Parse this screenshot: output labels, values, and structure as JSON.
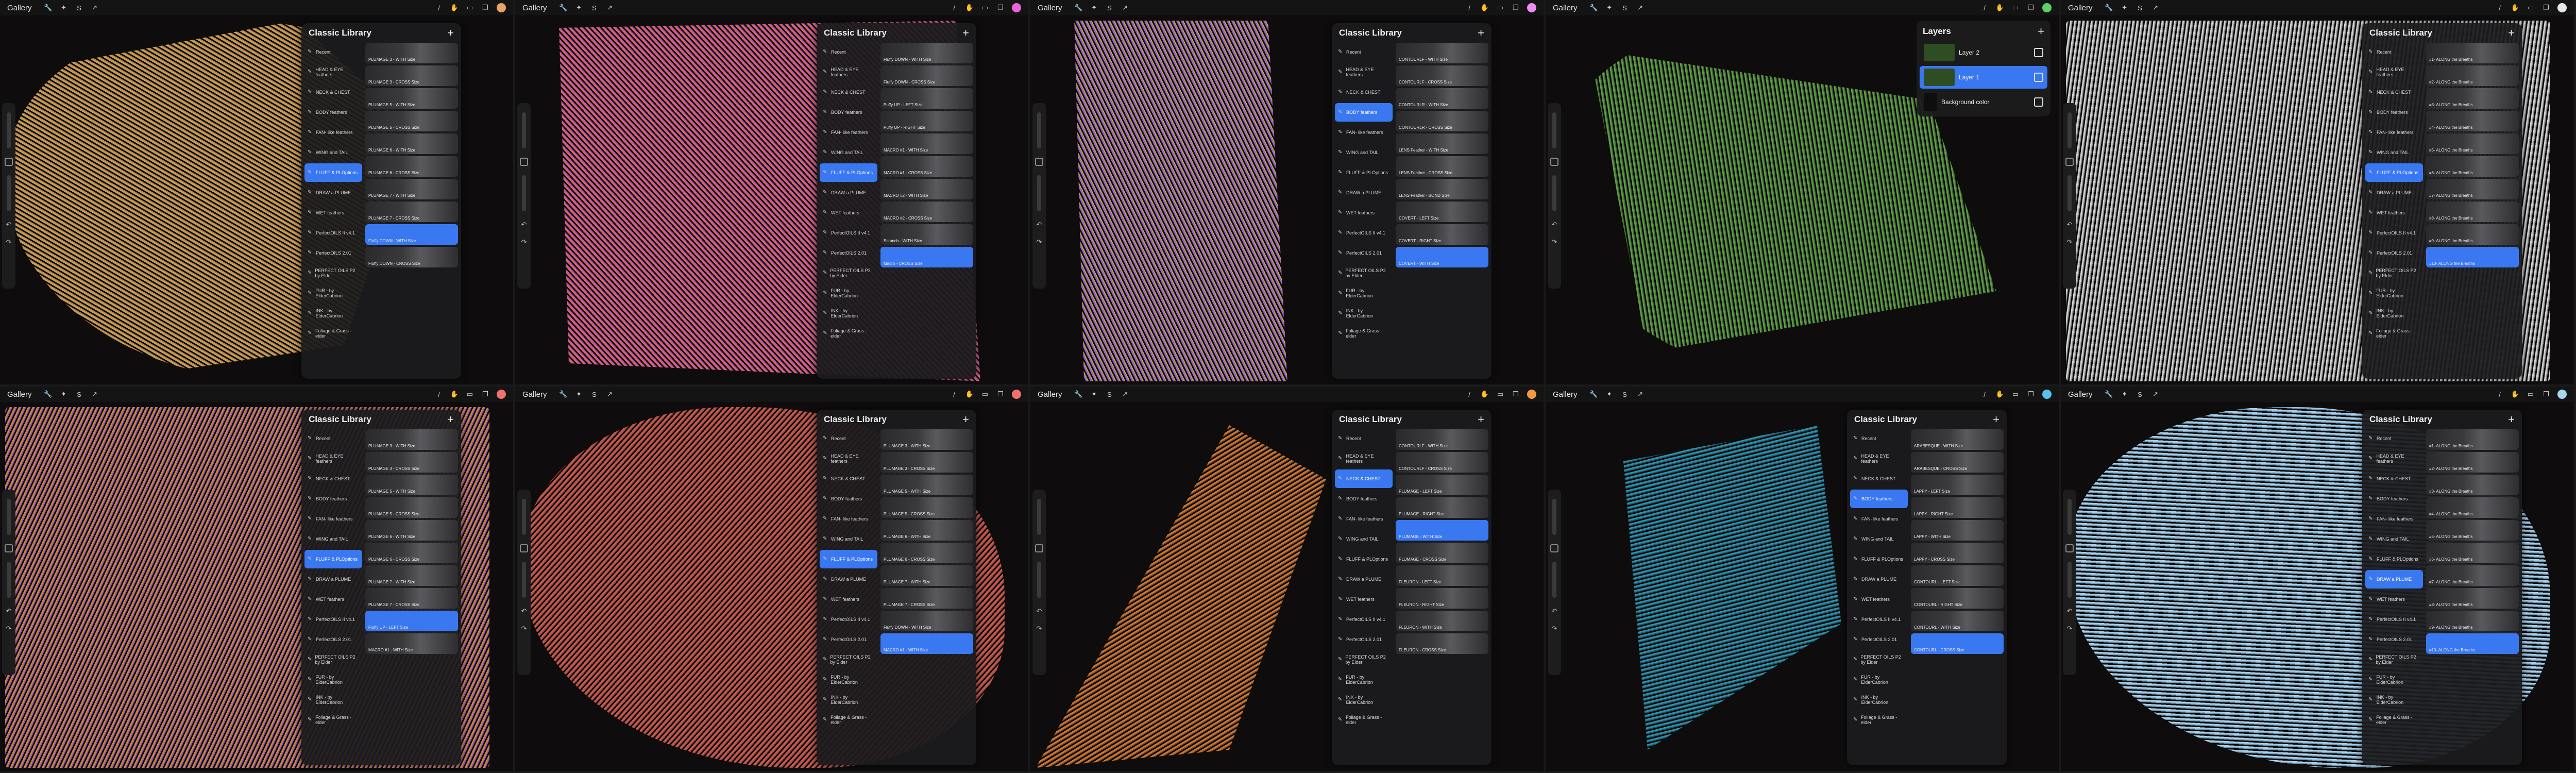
{
  "app": {
    "gallery_label": "Gallery"
  },
  "icons": {
    "wrench": "wrench-icon",
    "wand": "magic-wand-icon",
    "select": "selection-icon",
    "move": "transform-icon",
    "brush": "brush-icon",
    "smudge": "smudge-icon",
    "eraser": "eraser-icon",
    "layers": "layers-icon",
    "undo": "undo-icon",
    "redo": "redo-icon"
  },
  "tiles": [
    {
      "id": "t1",
      "color": "#e8a468",
      "art": "#b9a55a",
      "art2": "#c77a3f",
      "panel": "library",
      "active_cat": 5,
      "active_brush": 8,
      "brushes": [
        "PLUMAGE 3 - WITH Size",
        "PLUMAGE 3 - CROSS Size",
        "PLUMAGE 5 - WITH Size",
        "PLUMAGE 5 - CROSS Size",
        "PLUMAGE 6 - WITH Size",
        "PLUMAGE 6 - CROSS Size",
        "PLUMAGE 7 - WITH Size",
        "PLUMAGE 7 - CROSS Size",
        "Fluffy DOWN - WITH Size",
        "Fluffy DOWN - CROSS Size"
      ]
    },
    {
      "id": "t2",
      "color": "#e765d8",
      "art": "#d8685c",
      "art2": "#b24bc2",
      "panel": "library",
      "active_cat": 5,
      "active_brush": 9,
      "brushes": [
        "Fluffy DOWN - WITH Size",
        "Fluffy DOWN - CROSS Size",
        "Puffy UP - LEFT Size",
        "Puffy UP - RIGHT Size",
        "MACRO #1 - WITH Size",
        "MACRO #1 - CROSS Size",
        "MACRO #2 - WITH Size",
        "MACRO #2 - CROSS Size",
        "Scrunch - WITH Size",
        "Macro - CROSS Size"
      ]
    },
    {
      "id": "t3",
      "color": "#ee8cf0",
      "art": "#9a62c8",
      "art2": "#b7a24a",
      "panel": "library",
      "active_cat": 2,
      "active_brush": 9,
      "brushes": [
        "CONTOURLF - WITH Size",
        "CONTOURLF - CROSS Size",
        "CONTOURLR - WITH Size",
        "CONTOURLR - CROSS Size",
        "LENS Feather - WITH Size",
        "LENS Feather - CROSS Size",
        "LENS Feather - BOND Size",
        "COVERT - LEFT Size",
        "COVERT - RIGHT Size",
        "COVERT - WITH Size"
      ]
    },
    {
      "id": "t4",
      "color": "#5fd068",
      "art": "#5f9a48",
      "art2": "#3c6a2c",
      "panel": "layers",
      "layers_title": "Layers",
      "layer_rows": [
        "Layer 2",
        "Layer 1",
        "Background color"
      ],
      "active_layer": 1
    },
    {
      "id": "t5",
      "color": "#e6e6e6",
      "art": "#d0d0d0",
      "art2": "#8a8a8a",
      "panel": "library",
      "active_cat": 5,
      "active_brush": 9,
      "brushes": [
        "#1- ALONG the Breaths",
        "#2- ALONG the Breaths",
        "#3- ALONG the Breaths",
        "#4- ALONG the Breaths",
        "#5- ALONG the Breaths",
        "#6- ALONG the Breaths",
        "#7- ALONG the Breaths",
        "#8- ALONG the Breaths",
        "#9- ALONG the Breaths",
        "#10- ALONG the Breaths"
      ]
    },
    {
      "id": "t6",
      "color": "#f27070",
      "art": "#c08a3c",
      "art2": "#9a4cb8",
      "panel": "library",
      "active_cat": 5,
      "active_brush": 8,
      "brushes": [
        "PLUMAGE 3 - WITH Size",
        "PLUMAGE 3 - CROSS Size",
        "PLUMAGE 5 - WITH Size",
        "PLUMAGE 5 - CROSS Size",
        "PLUMAGE 6 - WITH Size",
        "PLUMAGE 6 - CROSS Size",
        "PLUMAGE 7 - WITH Size",
        "PLUMAGE 7 - CROSS Size",
        "Fluffy UP - LEFT Size",
        "MACRO #1 - WITH Size"
      ]
    },
    {
      "id": "t7",
      "color": "#f27070",
      "art": "#c45b4f",
      "art2": "#a84a42",
      "panel": "library",
      "active_cat": 5,
      "active_brush": 9,
      "brushes": [
        "PLUMAGE 3 - WITH Size",
        "PLUMAGE 3 - CROSS Size",
        "PLUMAGE 5 - WITH Size",
        "PLUMAGE 5 - CROSS Size",
        "PLUMAGE 6 - WITH Size",
        "PLUMAGE 6 - CROSS Size",
        "PLUMAGE 7 - WITH Size",
        "PLUMAGE 7 - CROSS Size",
        "Fluffy DOWN - WITH Size",
        "MACRO #1 - WITH Size"
      ]
    },
    {
      "id": "t8",
      "color": "#ef9a3e",
      "art": "#c87a38",
      "art2": "#8a4a1e",
      "panel": "library",
      "active_cat": 1,
      "active_brush": 4,
      "brushes": [
        "CONTOURLF - WITH Size",
        "CONTOURLF - CROSS Size",
        "PLUMAGE - LEFT Size",
        "PLUMAGE - RIGHT Size",
        "PLUMAGE - WITH Size",
        "PLUMAGE - CROSS Size",
        "FLEURON - LEFT Size",
        "FLEURON - RIGHT Size",
        "FLEURON - WITH Size",
        "FLEURON - CROSS Size"
      ]
    },
    {
      "id": "t9",
      "color": "#57c3ea",
      "art": "#2e90a8",
      "art2": "#1c5a72",
      "panel": "library",
      "active_cat": 2,
      "active_brush": 9,
      "brushes": [
        "ARABESQUE - WITH Size",
        "ARABESQUE - CROSS Size",
        "LAPPY - LEFT Size",
        "LAPPY - RIGHT Size",
        "LAPPY - WITH Size",
        "LAPPY - CROSS Size",
        "CONTOURL - LEFT Size",
        "CONTOURL - RIGHT Size",
        "CONTOURL - WITH Size",
        "CONTOURL - CROSS Size"
      ]
    },
    {
      "id": "t10",
      "color": "#a8d8f0",
      "art": "#a9cde6",
      "art2": "#6f9ab8",
      "panel": "library",
      "active_cat": 6,
      "active_brush": 9,
      "brushes": [
        "#1- ALONG the Breaths",
        "#2- ALONG the Breaths",
        "#3- ALONG the Breaths",
        "#4- ALONG the Breaths",
        "#5- ALONG the Breaths",
        "#6- ALONG the Breaths",
        "#7- ALONG the Breaths",
        "#8- ALONG the Breaths",
        "#9- ALONG the Breaths",
        "#10- ALONG the Breaths"
      ]
    }
  ],
  "library": {
    "title": "Classic Library",
    "plus": "+",
    "categories": [
      "Recent",
      "HEAD & EYE feathers",
      "NECK & CHEST",
      "BODY feathers",
      "FAN- like feathers",
      "WING and TAIL",
      "FLUFF & PLOptions",
      "DRAW a PLUME",
      "WET feathers",
      "PerfectOILS II v4.1",
      "PerfectOILS 2.01",
      "PERFECT OILS P2 by Elder",
      "FUR - by ElderCabrion",
      "INK - by ElderCabrion",
      "Foliage & Grass - elder"
    ]
  }
}
